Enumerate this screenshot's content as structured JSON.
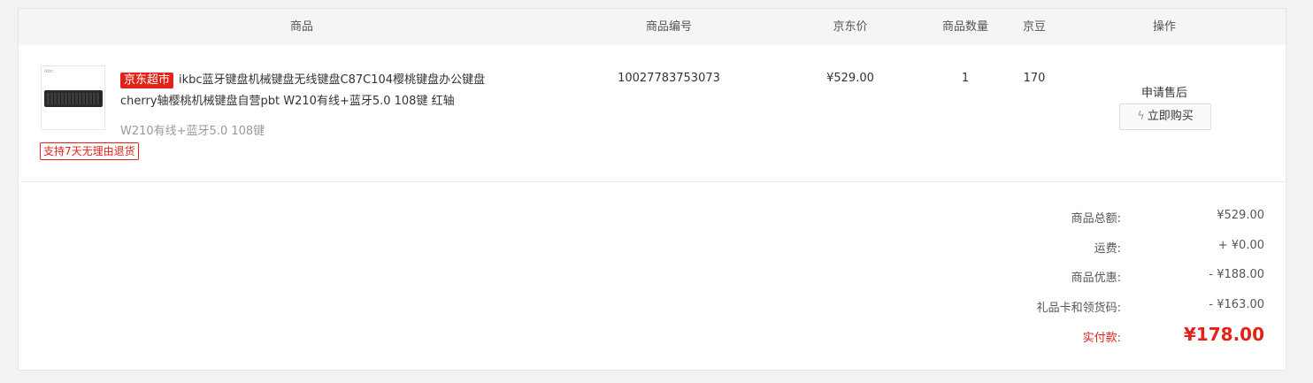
{
  "table": {
    "headers": {
      "product": "商品",
      "sku": "商品编号",
      "price": "京东价",
      "quantity": "商品数量",
      "beans": "京豆",
      "action": "操作"
    }
  },
  "item": {
    "thumb_brand": "ikbc",
    "badge": "京东超市",
    "title": "ikbc蓝牙键盘机械键盘无线键盘C87C104樱桃键盘办公键盘cherry轴樱桃机械键盘自营pbt W210有线+蓝牙5.0 108键 红轴",
    "spec": "W210有线+蓝牙5.0 108键",
    "return_policy": "支持7天无理由退货",
    "sku": "10027783753073",
    "price": "¥529.00",
    "quantity": "1",
    "beans": "170",
    "after_sale": "申请售后",
    "buy_again": "立即购买"
  },
  "summary": {
    "subtotal_label": "商品总额:",
    "subtotal": "¥529.00",
    "shipping_label": "运费:",
    "shipping": "+ ¥0.00",
    "discount_label": "商品优惠:",
    "discount": "- ¥188.00",
    "giftcard_label": "礼品卡和领货码:",
    "giftcard": "- ¥163.00",
    "total_label": "实付款:",
    "total": "¥178.00"
  },
  "colors": {
    "accent_red": "#e2231a"
  }
}
